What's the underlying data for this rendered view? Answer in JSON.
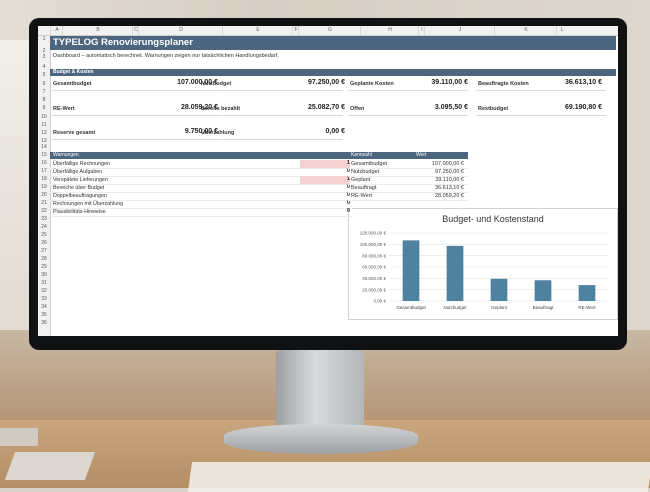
{
  "app": {
    "title": "TYPELOG Renovierungsplaner",
    "subtitle": "Dashboard – automatisch berechnet. Warnungen zeigen nur tatsächlichen Handlungsbedarf."
  },
  "columns": [
    "A",
    "B",
    "C",
    "D",
    "E",
    "F",
    "G",
    "H",
    "I",
    "J",
    "K",
    "L"
  ],
  "rows": [
    "1",
    "2",
    "3",
    "4",
    "5",
    "6",
    "7",
    "8",
    "9",
    "10",
    "11",
    "12",
    "13",
    "14",
    "15",
    "16",
    "17",
    "18",
    "19",
    "20",
    "21",
    "22",
    "23",
    "24",
    "25",
    "26",
    "27",
    "28",
    "29",
    "30",
    "31",
    "32",
    "33",
    "34",
    "35",
    "36"
  ],
  "budget_section": {
    "title": "Budget & Kosten"
  },
  "kpis": {
    "gesamtbudget": {
      "label": "Gesamtbudget",
      "value": "107.000,00 €"
    },
    "nutzbudget": {
      "label": "Nutzbudget",
      "value": "97.250,00 €"
    },
    "geplant": {
      "label": "Geplante Kosten",
      "value": "39.110,00 €"
    },
    "beauftragt": {
      "label": "Beauftragte Kosten",
      "value": "36.613,10 €"
    },
    "rewert": {
      "label": "RE-Wert",
      "value": "28.059,20 €"
    },
    "bezahlt": {
      "label": "Bereits bezahlt",
      "value": "25.082,70 €"
    },
    "offen": {
      "label": "Offen",
      "value": "3.095,50 €"
    },
    "restbudget": {
      "label": "Restbudget",
      "value": "69.190,80 €"
    },
    "reserve": {
      "label": "Reserve gesamt",
      "value": "9.750,00 €"
    },
    "ueberzahlung": {
      "label": "Überzahlung",
      "value": "0,00 €"
    }
  },
  "warnings": {
    "title": "Warnungen",
    "items": [
      {
        "label": "Überfällige Rechnungen",
        "value": "1"
      },
      {
        "label": "Überfällige Aufgaben",
        "value": "0"
      },
      {
        "label": "Verspätete Lieferungen",
        "value": "1"
      },
      {
        "label": "Bereiche über Budget",
        "value": "0"
      },
      {
        "label": "Doppelbeauftragungen",
        "value": "0"
      },
      {
        "label": "Rechnungen mit Überzahlung",
        "value": "0"
      },
      {
        "label": "Plausibilitäts-Hinweise",
        "value": "0"
      }
    ]
  },
  "kosten_table": {
    "col_kennzahl": "Kennzahl",
    "col_wert": "Wert",
    "rows": [
      {
        "name": "Gesamtbudget",
        "value": "107.000,00 €"
      },
      {
        "name": "Nutzbudget",
        "value": "97.250,00 €"
      },
      {
        "name": "Geplant",
        "value": "39.110,00 €"
      },
      {
        "name": "Beauftragt",
        "value": "36.613,10 €"
      },
      {
        "name": "RE-Wert",
        "value": "28.059,20 €"
      }
    ]
  },
  "colors": {
    "header": "#4d6680",
    "bar": "#4f82a0",
    "warn": "#f5d2d2"
  },
  "chart_data": {
    "type": "bar",
    "title": "Budget- und Kostenstand",
    "categories": [
      "Gesamtbudget",
      "Nutzbudget",
      "Geplant",
      "Beauftragt",
      "RE-Wert"
    ],
    "values": [
      107000,
      97250,
      39110,
      36613.1,
      28059.2
    ],
    "yticks": [
      "0,00 €",
      "20.000,00 €",
      "40.000,00 €",
      "60.000,00 €",
      "80.000,00 €",
      "100.000,00 €",
      "120.000,00 €"
    ],
    "ylim": [
      0,
      120000
    ],
    "grid": true
  }
}
